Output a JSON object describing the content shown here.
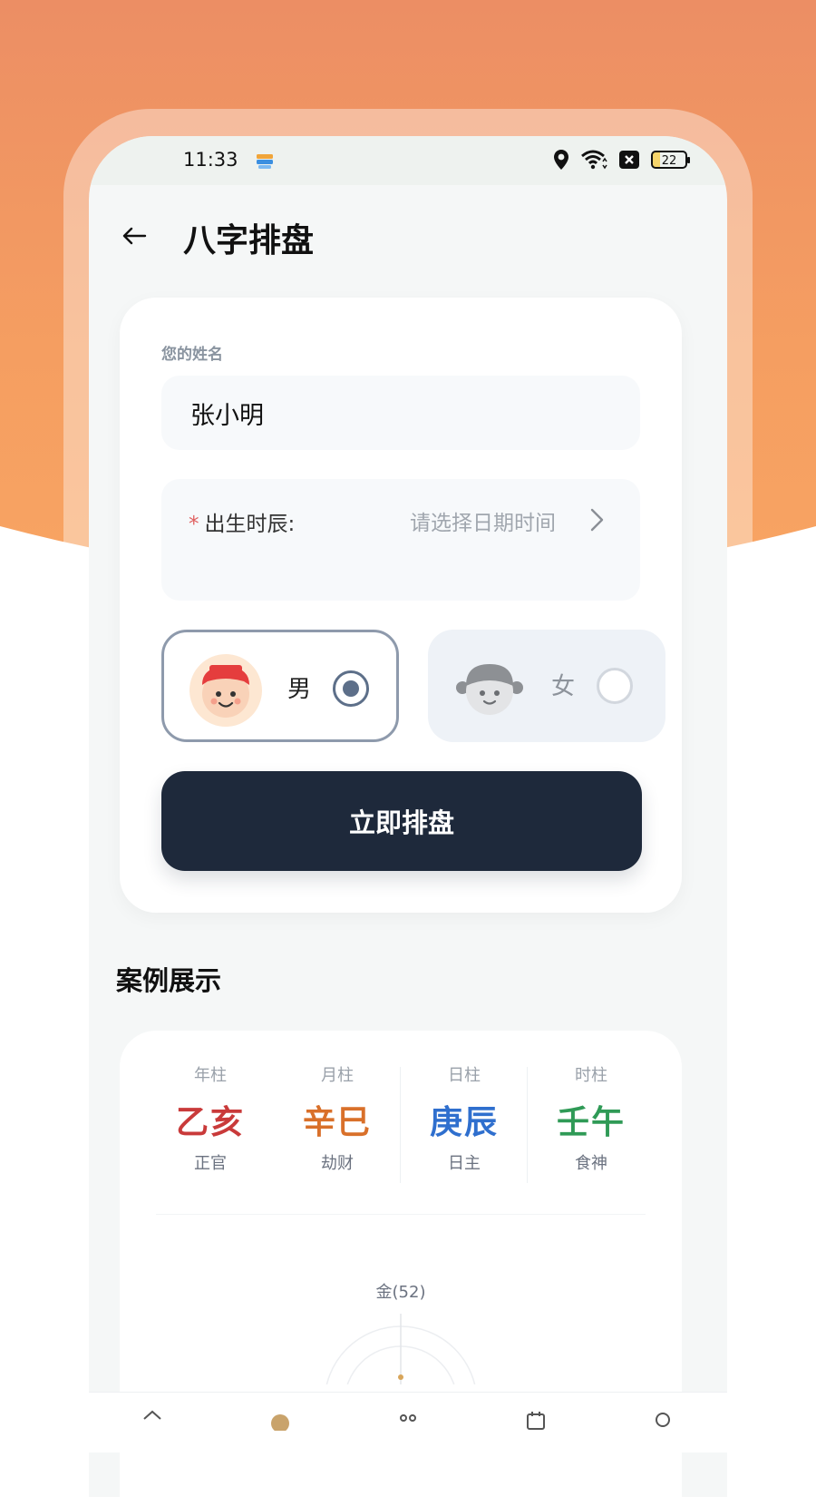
{
  "status_bar": {
    "time": "11:33",
    "battery": "22"
  },
  "nav": {
    "title": "八字排盘"
  },
  "form": {
    "name_label": "您的姓名",
    "name_value": "张小明",
    "required_mark": "*",
    "birth_label": "出生时辰:",
    "birth_placeholder": "请选择日期时间",
    "gender": {
      "male_label": "男",
      "female_label": "女",
      "selected": "男"
    },
    "submit_label": "立即排盘"
  },
  "cases": {
    "title": "案例展示",
    "pillars": [
      {
        "label": "年柱",
        "ganzhi": "乙亥",
        "shishen": "正官",
        "color": "#c93a3a"
      },
      {
        "label": "月柱",
        "ganzhi": "辛巳",
        "shishen": "劫财",
        "color": "#d9702a"
      },
      {
        "label": "日柱",
        "ganzhi": "庚辰",
        "shishen": "日主",
        "color": "#2f6fce"
      },
      {
        "label": "时柱",
        "ganzhi": "壬午",
        "shishen": "食神",
        "color": "#2f9a56"
      }
    ],
    "element_label": "金(52)"
  },
  "colors": {
    "accent": "#1e293b",
    "header_gradient": "#ec8e64",
    "selected_border": "#8e9aac"
  },
  "icons": {
    "back": "arrow-left-icon",
    "chevron": "chevron-right-icon",
    "tabs": [
      "home-icon",
      "bazi-icon",
      "people-icon",
      "calendar-icon",
      "search-icon"
    ]
  }
}
